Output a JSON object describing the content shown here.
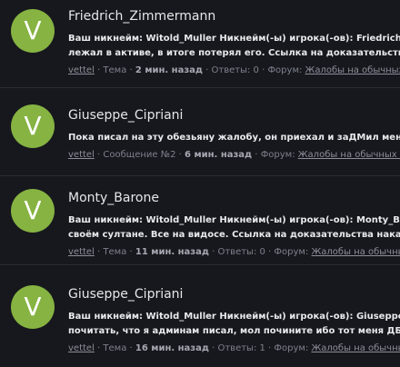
{
  "items": [
    {
      "avatar_letter": "V",
      "title": "Friedrich_Zimmermann",
      "snippet_line1": "Ваш никнейм: Witold_Muller Никнейм(-ы) игрока(-ов): Friedrich_Zimmermann",
      "snippet_line2": "лежал в активе, в итоге потерял его. Ссылка на доказательства наказания",
      "author": "vettel",
      "type": "Тема",
      "time": "2 мин. назад",
      "replies": "Ответы: 0",
      "forum_label": "Форум:",
      "forum": "Жалобы на обычных игроков"
    },
    {
      "avatar_letter": "V",
      "title": "Giuseppe_Cipriani",
      "snippet_line1": "Пока писал на эту обезьяну жалобу, он приехал и заДМил меня со своим",
      "author": "vettel",
      "type": "Сообщение №2",
      "time": "6 мин. назад",
      "forum_label": "Форум:",
      "forum": "Жалобы на обычных игроков"
    },
    {
      "avatar_letter": "V",
      "title": "Monty_Barone",
      "snippet_line1": "Ваш никнейм: Witold_Muller Никнейм(-ы) игрока(-ов): Monty_Barone",
      "snippet_line2": "своём султане. Все на видосе. Ссылка на доказательства наказания",
      "author": "vettel",
      "type": "Тема",
      "time": "11 мин. назад",
      "replies": "Ответы: 0",
      "forum_label": "Форум:",
      "forum": "Жалобы на обычных игроков"
    },
    {
      "avatar_letter": "V",
      "title": "Giuseppe_Cipriani",
      "snippet_line1": "Ваш никнейм: Witold_Muller Никнейм(-ы) игрока(-ов): Giuseppe_Cipriani",
      "snippet_line2": "почитать, что я админам писал, мол почините ибо тот меня ДБшил",
      "author": "vettel",
      "type": "Тема",
      "time": "16 мин. назад",
      "replies": "Ответы: 1",
      "forum_label": "Форум:",
      "forum": "Жалобы на обычных игроков"
    }
  ],
  "colors": {
    "background": "#17181d",
    "avatar": "#86b342",
    "divider": "#2a2c33",
    "title": "#e6e7ea",
    "meta": "#7d818c"
  }
}
